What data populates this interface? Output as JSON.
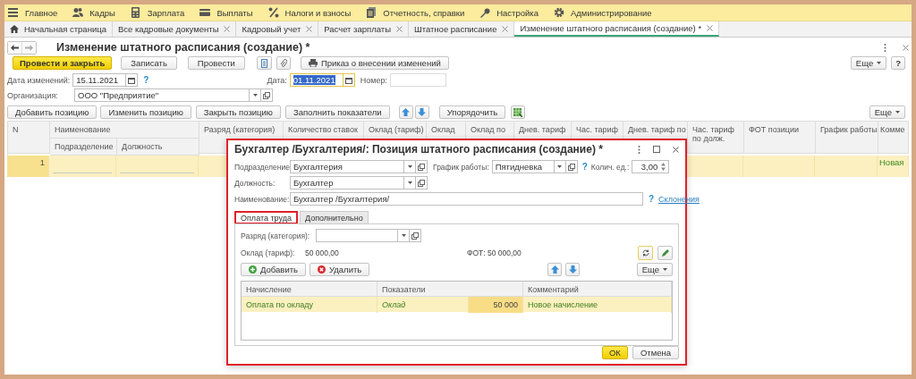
{
  "menu": [
    {
      "label": "Главное"
    },
    {
      "label": "Кадры"
    },
    {
      "label": "Зарплата"
    },
    {
      "label": "Выплаты"
    },
    {
      "label": "Налоги и взносы"
    },
    {
      "label": "Отчетность, справки"
    },
    {
      "label": "Настройка"
    },
    {
      "label": "Администрирование"
    }
  ],
  "tabs": [
    {
      "label": "Начальная страница",
      "selected": false
    },
    {
      "label": "Все кадровые документы",
      "selected": false
    },
    {
      "label": "Кадровый учет",
      "selected": false
    },
    {
      "label": "Расчет зарплаты",
      "selected": false
    },
    {
      "label": "Штатное расписание",
      "selected": false
    },
    {
      "label": "Изменение штатного расписания (создание) *",
      "selected": true
    }
  ],
  "form": {
    "title": "Изменение штатного расписания (создание) *",
    "toolbar": [
      {
        "kind": "primary",
        "label": "Провести и закрыть"
      },
      {
        "kind": "plain",
        "label": "Записать"
      },
      {
        "kind": "plain",
        "label": "Провести"
      },
      {
        "kind": "list"
      },
      {
        "kind": "clip"
      },
      {
        "kind": "print",
        "label": "Приказ о внесении изменений"
      }
    ],
    "more": "Еще",
    "help": "?",
    "change_date": {
      "label": "Дата изменений:",
      "value": "15.11.2021",
      "help": "?"
    },
    "date": {
      "label": "Дата:",
      "value": "01.11.2021",
      "selected": true
    },
    "number": {
      "label": "Номер:"
    },
    "organization": {
      "label": "Организация:",
      "value": "ООО \"Предприятие\""
    },
    "table_buttons": [
      {
        "label": "Добавить позицию"
      },
      {
        "label": "Изменить позицию"
      },
      {
        "label": "Закрыть позицию"
      },
      {
        "label": "Заполнить показатели"
      }
    ],
    "sort": "Упорядочить",
    "table_more": "Еще"
  },
  "table": {
    "columns": [
      {
        "label": "N"
      },
      {
        "label": "Наименование",
        "children": [
          {
            "label": "Подразделение"
          },
          {
            "label": "Должность"
          }
        ]
      },
      {
        "label": "Разряд (категория)"
      },
      {
        "label": "Количество ставок"
      },
      {
        "label": "Оклад (тариф)"
      },
      {
        "label": "Оклад"
      },
      {
        "label": "Оклад по"
      },
      {
        "label": "Днев. тариф"
      },
      {
        "label": "Час. тариф"
      },
      {
        "label": "Днев. тариф по"
      },
      {
        "label": "Час. тариф по долж."
      },
      {
        "label": "ФОТ позиции"
      },
      {
        "label": "График работы"
      },
      {
        "label": "Комме"
      }
    ],
    "rows": [
      {
        "n": "1",
        "comment": "Новая",
        "selected": true
      }
    ]
  },
  "dialog": {
    "title": "Бухгалтер /Бухгалтерия/: Позиция штатного расписания (создание) *",
    "highlighted": true,
    "department": {
      "label": "Подразделение:",
      "value": "Бухгалтерия"
    },
    "schedule": {
      "label": "График работы:",
      "value": "Пятидневка",
      "help": "?"
    },
    "units": {
      "label": "Колич. ед.:",
      "value": "3,00"
    },
    "position": {
      "label": "Должность:",
      "value": "Бухгалтер"
    },
    "name": {
      "label": "Наименование:",
      "value": "Бухгалтер /Бухгалтерия/",
      "help": "?",
      "link": "Склонения"
    },
    "tabs": [
      {
        "label": "Оплата труда",
        "selected": true,
        "highlighted": true
      },
      {
        "label": "Дополнительно",
        "selected": false,
        "highlighted": false
      }
    ],
    "grade": {
      "label": "Разряд (категория):"
    },
    "salary": {
      "label": "Оклад (тариф):",
      "value": "50 000,00"
    },
    "fot": "ФОТ: 50 000,00",
    "add": "Добавить",
    "delete": "Удалить",
    "more": "Еще",
    "accruals": {
      "columns": [
        "Начисление",
        "Показатели",
        "Комментарий"
      ],
      "rows": [
        {
          "accrual": "Оплата по окладу",
          "indicator": "Оклад",
          "value": "50 000",
          "comment": "Новое начисление",
          "selected": true
        }
      ]
    },
    "ok": "ОК",
    "cancel": "Отмена"
  }
}
